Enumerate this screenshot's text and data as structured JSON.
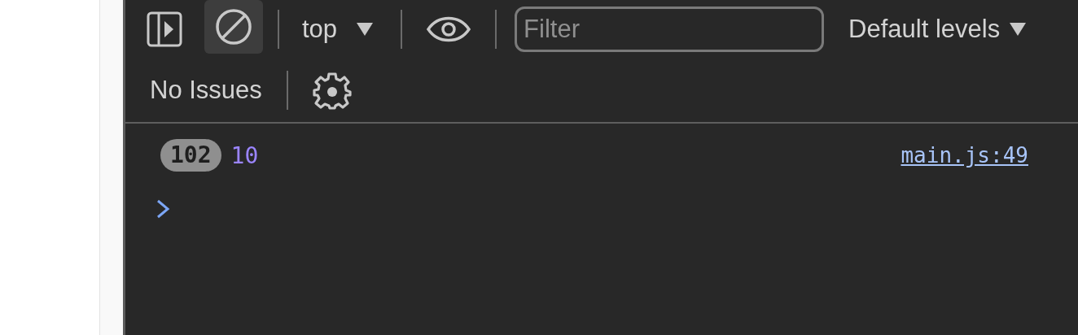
{
  "toolbar": {
    "sidebar_button": {
      "pressed": false
    },
    "clear_button": {
      "pressed": true
    },
    "context": "top",
    "filter": {
      "placeholder": "Filter"
    },
    "levels": "Default levels"
  },
  "issues": {
    "label": "No Issues"
  },
  "messages": [
    {
      "count": "102",
      "value": "10",
      "source": "main.js:49"
    }
  ]
}
